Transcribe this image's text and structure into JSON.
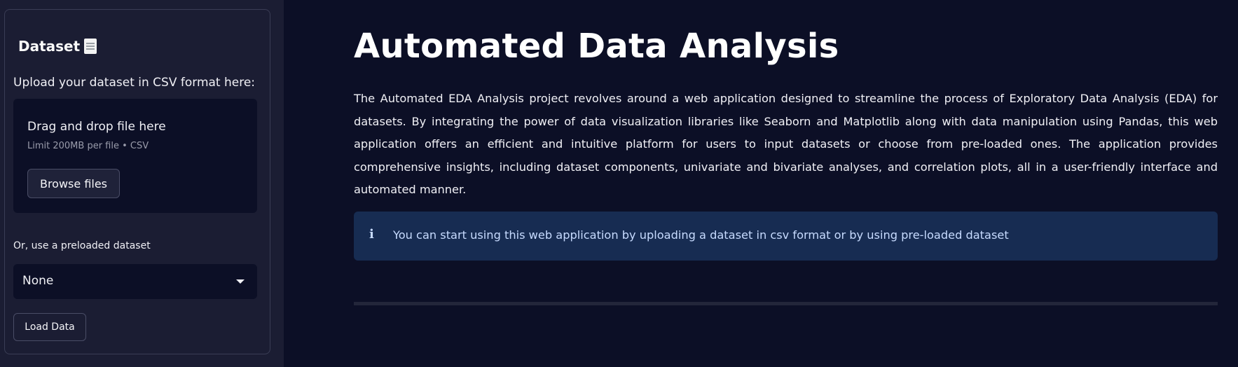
{
  "sidebar": {
    "title": "Dataset",
    "title_icon": "document-icon",
    "upload_label": "Upload your dataset in CSV format here:",
    "dropzone": {
      "main_text": "Drag and drop file here",
      "sub_text": "Limit 200MB per file • CSV",
      "browse_label": "Browse files"
    },
    "preload_label": "Or, use a preloaded dataset",
    "select_value": "None",
    "load_button": "Load Data"
  },
  "main": {
    "title": "Automated Data Analysis",
    "description": "The Automated EDA Analysis project revolves around a web application designed to streamline the process of Exploratory Data Analysis (EDA) for datasets. By integrating the power of data visualization libraries like Seaborn and Matplotlib along with data manipulation using Pandas, this web application offers an efficient and intuitive platform for users to input datasets or choose from pre-loaded ones. The application provides comprehensive insights, including dataset components, univariate and bivariate analyses, and correlation plots, all in a user-friendly interface and automated manner.",
    "info": {
      "icon": "info-icon",
      "text": "You can start using this web application by uploading a dataset in csv format or by using pre-loaded dataset"
    }
  },
  "colors": {
    "background": "#0c0f26",
    "sidebar_bg": "#1b1d33",
    "info_bg": "#172c52",
    "info_text": "#c7dbff"
  }
}
